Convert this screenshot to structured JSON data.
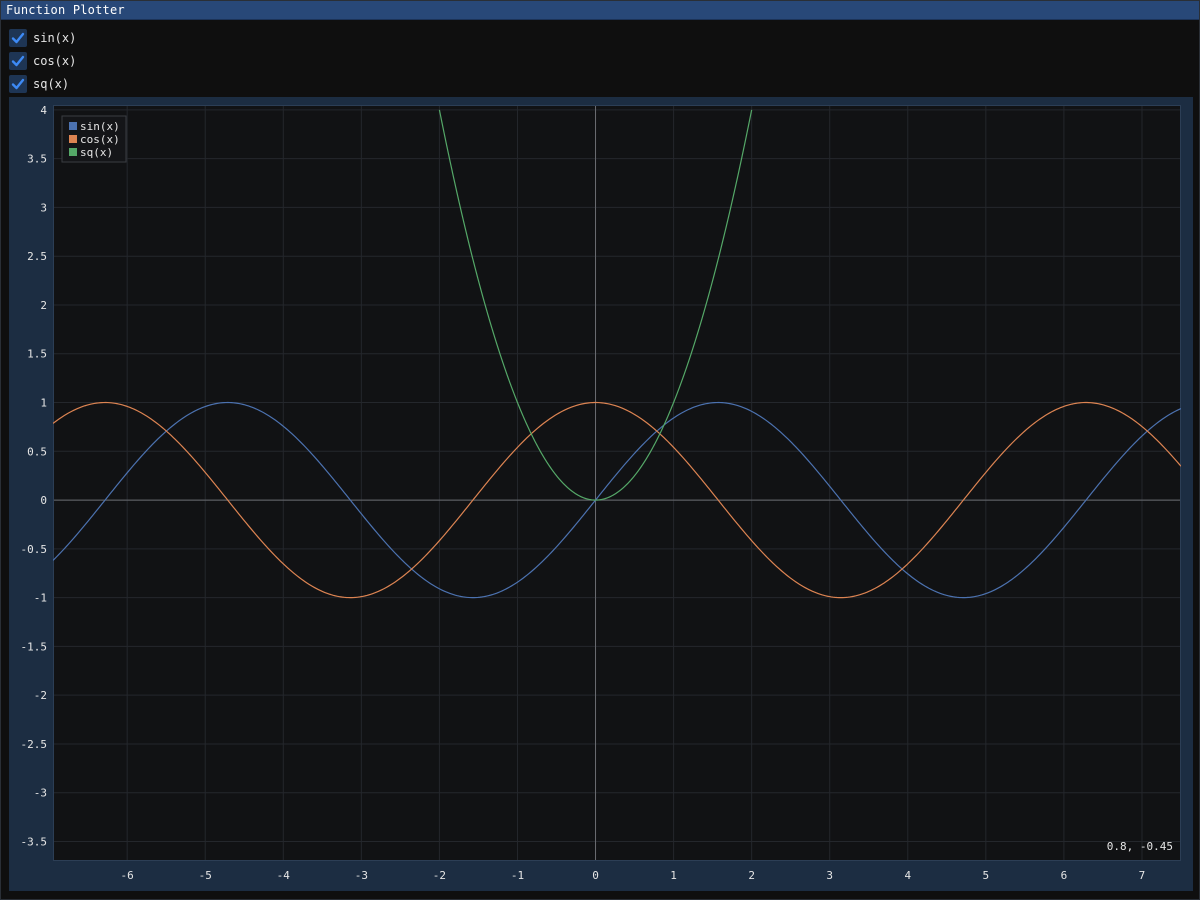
{
  "window": {
    "title": "Function Plotter"
  },
  "toggles": [
    {
      "label": "sin(x)",
      "checked": true
    },
    {
      "label": "cos(x)",
      "checked": true
    },
    {
      "label": "sq(x)",
      "checked": true
    }
  ],
  "plot": {
    "mouse_coords": "0.8, -0.45"
  },
  "colors": {
    "titlebar": "#284878",
    "checkbox_bg": "#1e3554",
    "checkmark": "#3d8af5",
    "plot_frame": "#1c2d42",
    "plot_bg": "#111214",
    "grid": "#24272c",
    "axis": "#6a6d72"
  },
  "chart_data": {
    "type": "line",
    "title": "",
    "xlabel": "",
    "ylabel": "",
    "xlim": [
      -6.95,
      7.5
    ],
    "ylim": [
      -3.7,
      4.05
    ],
    "x_ticks": [
      -6,
      -5,
      -4,
      -3,
      -2,
      -1,
      0,
      1,
      2,
      3,
      4,
      5,
      6,
      7
    ],
    "y_ticks": [
      -3.5,
      -3,
      -2.5,
      -2,
      -1.5,
      -1,
      -0.5,
      0,
      0.5,
      1,
      1.5,
      2,
      2.5,
      3,
      3.5,
      4
    ],
    "grid": true,
    "legend_position": "top-left",
    "series": [
      {
        "name": "sin(x)",
        "color": "#4c72b0",
        "function": "sin",
        "x": [
          -6.95,
          -6.28,
          -5.5,
          -4.71,
          -3.93,
          -3.14,
          -2.36,
          -1.57,
          -0.79,
          0,
          0.79,
          1.57,
          2.36,
          3.14,
          3.93,
          4.71,
          5.5,
          6.28,
          7.07,
          7.5
        ],
        "values": [
          -0.62,
          0,
          0.71,
          1,
          0.71,
          0,
          -0.71,
          -1,
          -0.71,
          0,
          0.71,
          1,
          0.71,
          0,
          -0.71,
          -1,
          -0.71,
          0,
          0.71,
          0.94
        ]
      },
      {
        "name": "cos(x)",
        "color": "#dd8452",
        "function": "cos",
        "x": [
          -6.95,
          -6.28,
          -5.5,
          -4.71,
          -3.93,
          -3.14,
          -2.36,
          -1.57,
          -0.79,
          0,
          0.79,
          1.57,
          2.36,
          3.14,
          3.93,
          4.71,
          5.5,
          6.28,
          7.07,
          7.5
        ],
        "values": [
          0.79,
          1,
          0.71,
          0,
          -0.71,
          -1,
          -0.71,
          0,
          0.71,
          1,
          0.71,
          0,
          -0.71,
          -1,
          -0.71,
          0,
          0.71,
          1,
          0.71,
          0.35
        ]
      },
      {
        "name": "sq(x)",
        "color": "#55a868",
        "function": "square",
        "x": [
          -2,
          -1.5,
          -1,
          -0.5,
          0,
          0.5,
          1,
          1.5,
          2
        ],
        "values": [
          4,
          2.25,
          1,
          0.25,
          0,
          0.25,
          1,
          2.25,
          4
        ]
      }
    ]
  }
}
